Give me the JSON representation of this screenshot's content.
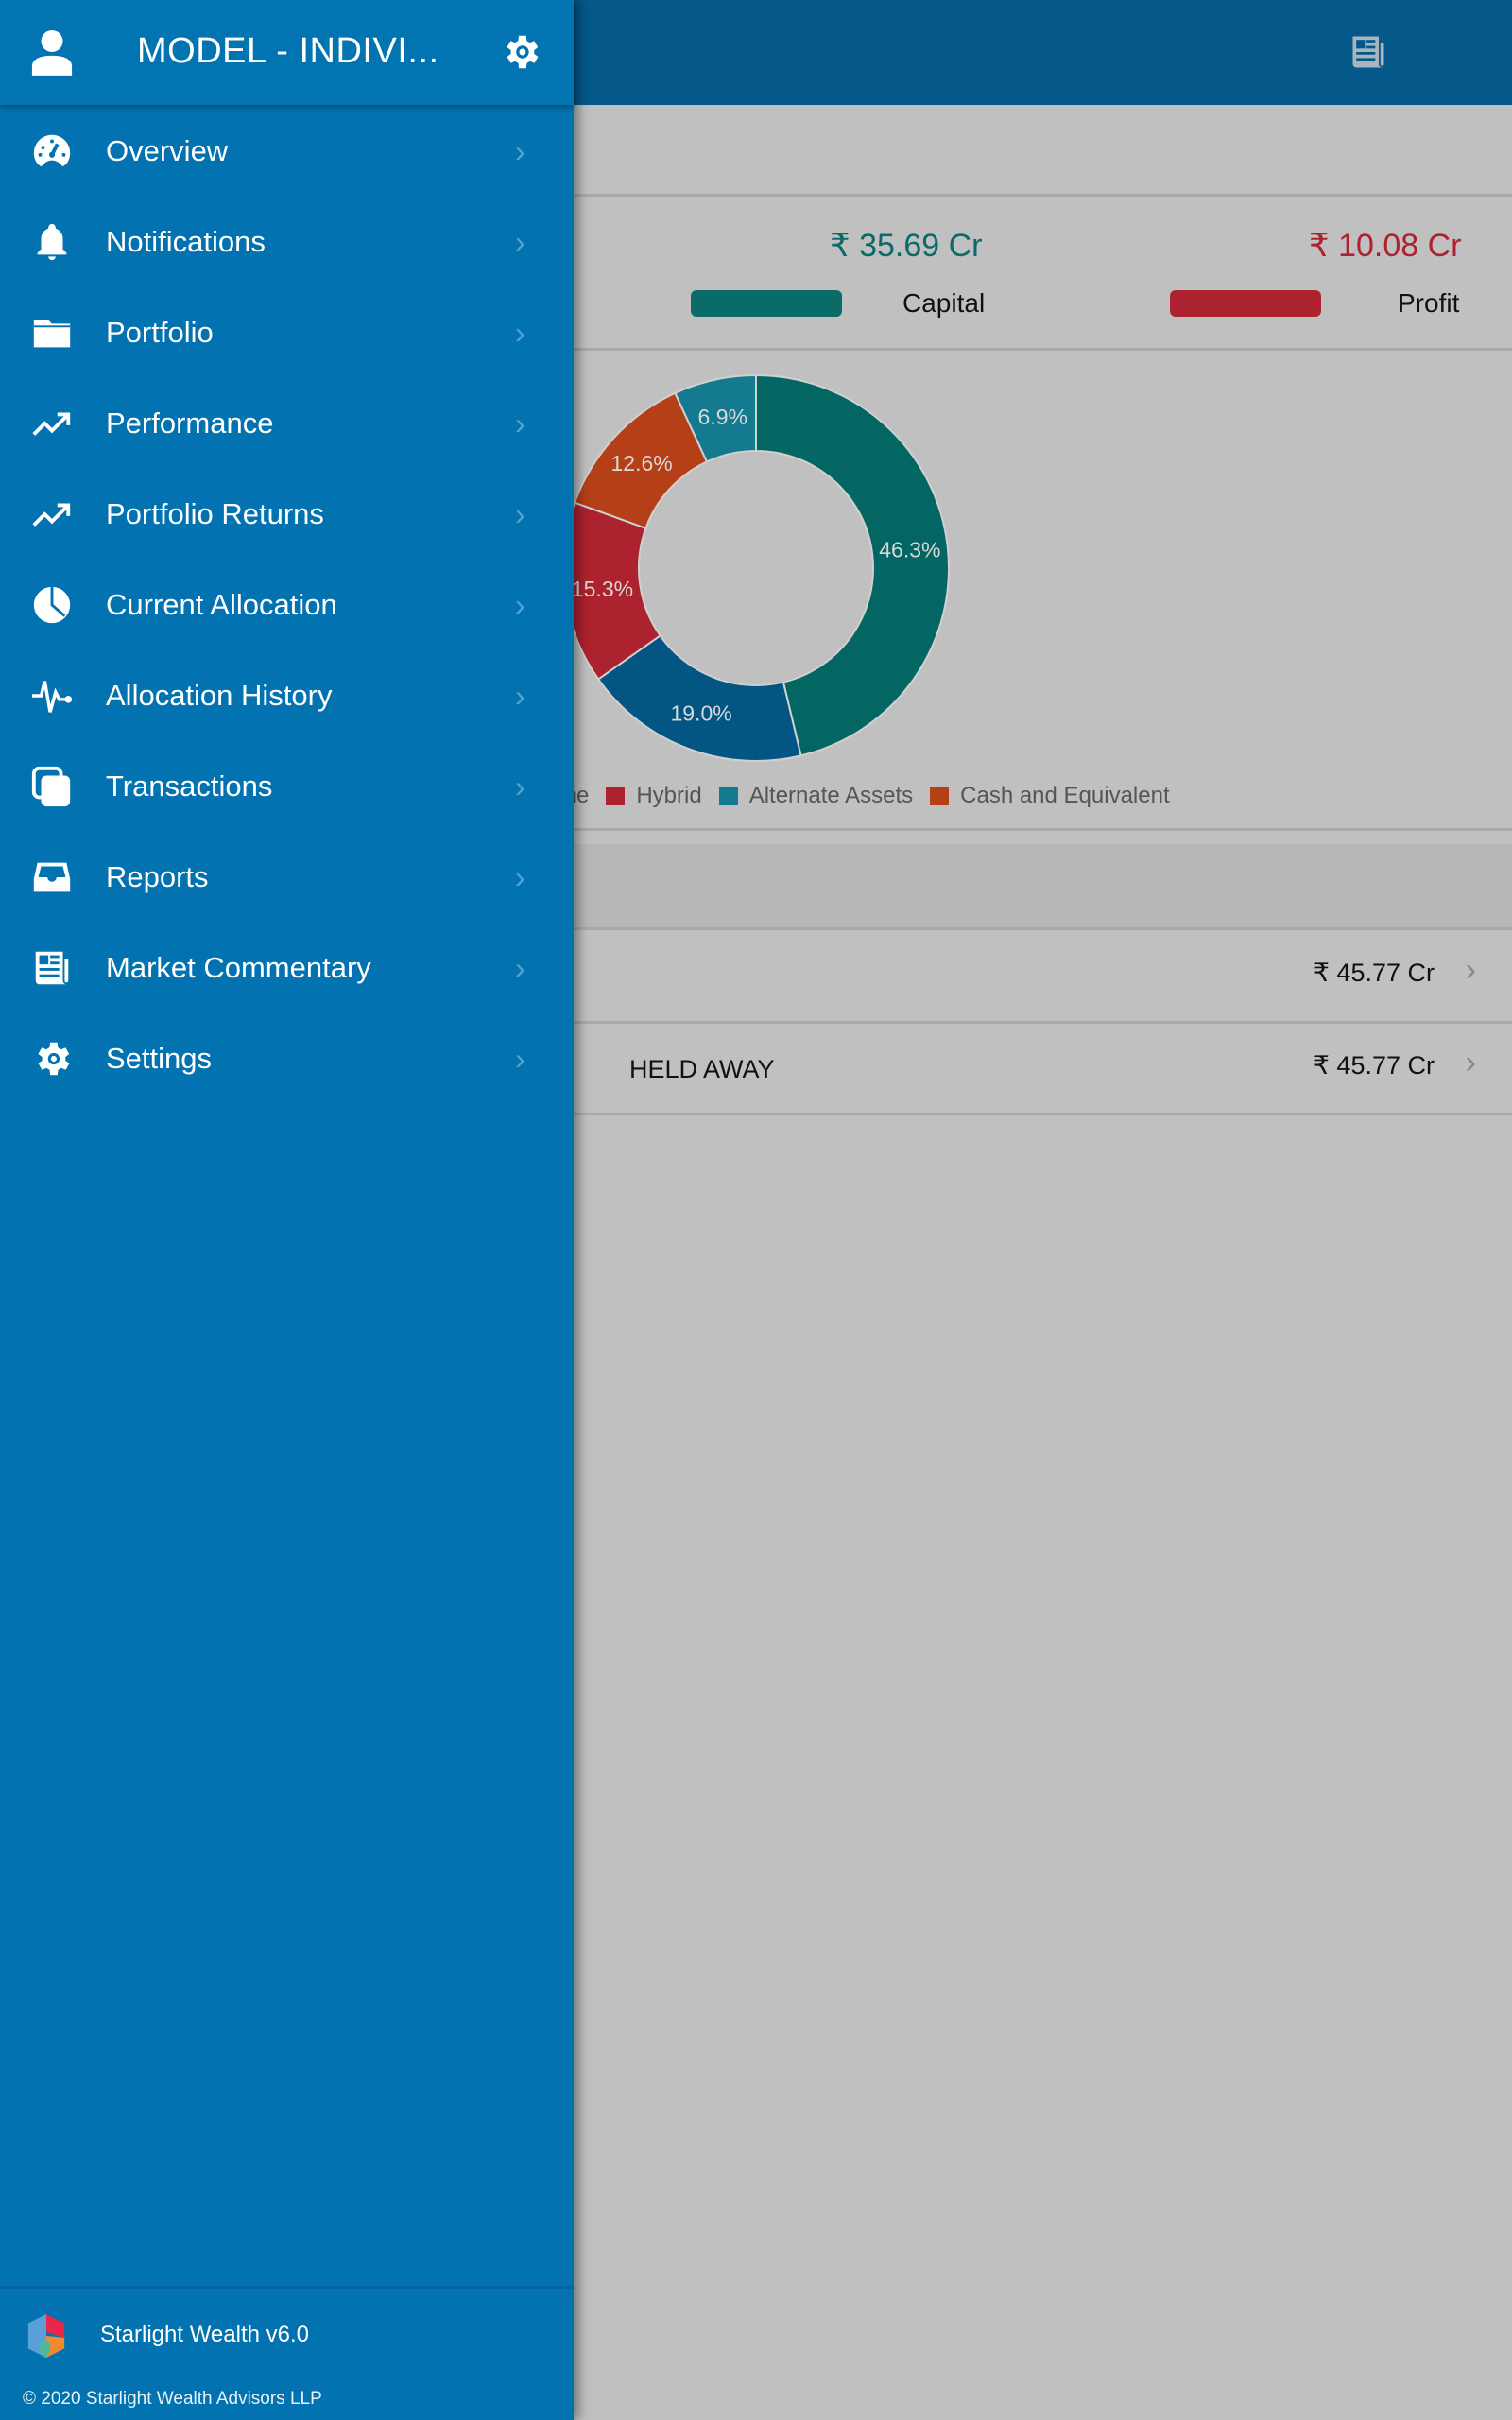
{
  "header": {
    "title": "MODEL - INDIVI...",
    "account_icon": "user-icon",
    "settings_icon": "gear-icon",
    "news_icon": "newspaper-icon"
  },
  "menu": [
    {
      "label": "Overview",
      "icon": "speedometer-icon"
    },
    {
      "label": "Notifications",
      "icon": "bell-icon"
    },
    {
      "label": "Portfolio",
      "icon": "folder-icon"
    },
    {
      "label": "Performance",
      "icon": "trending-up-icon"
    },
    {
      "label": "Portfolio Returns",
      "icon": "trending-up-icon"
    },
    {
      "label": "Current Allocation",
      "icon": "pie-chart-icon"
    },
    {
      "label": "Allocation History",
      "icon": "pulse-icon"
    },
    {
      "label": "Transactions",
      "icon": "copy-icon"
    },
    {
      "label": "Reports",
      "icon": "inbox-icon"
    },
    {
      "label": "Market Commentary",
      "icon": "newspaper-icon"
    },
    {
      "label": "Settings",
      "icon": "gear-icon"
    }
  ],
  "footer": {
    "app_version": "Starlight Wealth v6.0",
    "copyright": "© 2020 Starlight Wealth Advisors LLP"
  },
  "summary": {
    "capital": {
      "value": "₹ 35.69 Cr",
      "label": "Capital",
      "color": "#0b6b68"
    },
    "profit": {
      "value": "₹ 10.08 Cr",
      "label": "Profit",
      "color": "#ad222f"
    }
  },
  "chart_data": {
    "type": "pie",
    "donut": true,
    "slices": [
      {
        "value": 46.3,
        "label": "46.3%",
        "color": "#036663"
      },
      {
        "value": 19.0,
        "label": "19.0%",
        "color": "#035583"
      },
      {
        "value": 15.3,
        "label": "15.3%",
        "color": "#ad222f"
      },
      {
        "value": 12.6,
        "label": "12.6%",
        "color": "#b53f16"
      },
      {
        "value": 6.9,
        "label": "6.9%",
        "color": "#147a90"
      }
    ],
    "legend": [
      {
        "name": "me",
        "color": "#035583"
      },
      {
        "name": "Hybrid",
        "color": "#ad222f"
      },
      {
        "name": "Alternate Assets",
        "color": "#147a90"
      },
      {
        "name": "Cash and Equivalent",
        "color": "#b53f16"
      }
    ],
    "legend_position": "bottom"
  },
  "rows": [
    {
      "label": "",
      "value": "₹ 45.77 Cr"
    },
    {
      "label": "HELD AWAY",
      "value": "₹ 45.77 Cr"
    }
  ]
}
